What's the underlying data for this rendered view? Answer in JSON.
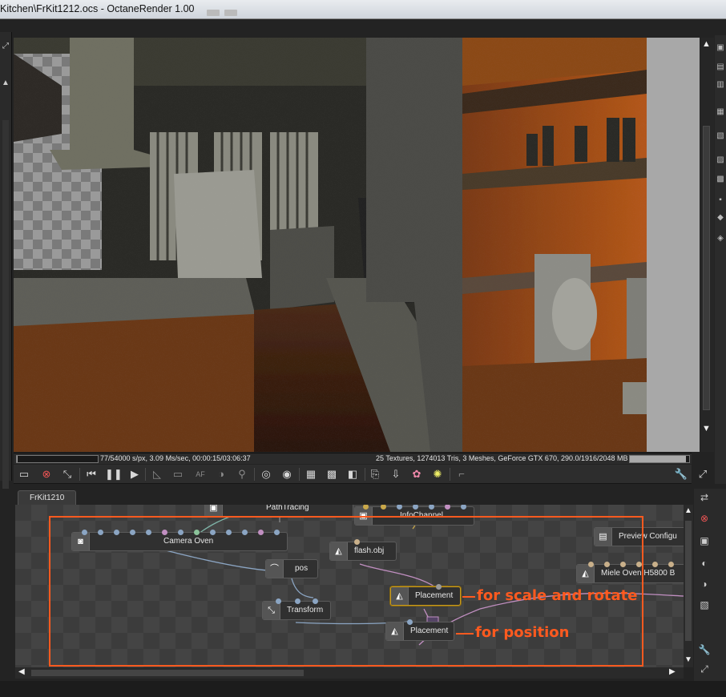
{
  "window": {
    "title": "Kitchen\\FrKit1212.ocs - OctaneRender 1.00"
  },
  "statusbar": {
    "render_stats": "77/54000 s/px, 3.09 Ms/sec, 00:00:15/03:06:37",
    "scene_stats": "25 Textures, 1274013 Tris, 3 Meshes, GeForce GTX 670, 290.0/1916/2048 MB",
    "progress_fraction": 0.0014,
    "memory_fraction": 0.94
  },
  "toolbar": {
    "icons": [
      "save-render-icon",
      "clear-render-icon",
      "fit-view-icon",
      "restart-render-icon",
      "pause-render-icon",
      "start-render-icon",
      "pick-focus-icon",
      "region-render-icon",
      "autofocus-icon",
      "pick-white-point-icon",
      "pick-material-icon",
      "lock-viewport-icon",
      "unlock-viewport-icon",
      "alpha-channel-icon",
      "checker-background-icon",
      "half-resolution-icon",
      "copy-clipboard-icon",
      "import-icon",
      "material-picker-icon",
      "light-icon",
      "lock-icon"
    ],
    "right_icons": [
      "settings-wrench-icon",
      "fullscreen-icon"
    ]
  },
  "graph": {
    "tab_label": "FrKit1210",
    "nodes": {
      "pathtracing": "PathTracing",
      "infochannel": "InfoChannel",
      "camera": "Camera Oven",
      "flash": "flash.obj",
      "pos": "pos",
      "placement1": "Placement",
      "transform": "Transform",
      "placement2": "Placement",
      "preview": "Preview Configu",
      "miele": "Miele Oven H5800 B"
    },
    "annotations": {
      "scale_rotate": "for scale and rotate",
      "position": "for position"
    },
    "colors": {
      "annotation": "#ff5a1f",
      "selected_border": "#c79a1f"
    }
  }
}
